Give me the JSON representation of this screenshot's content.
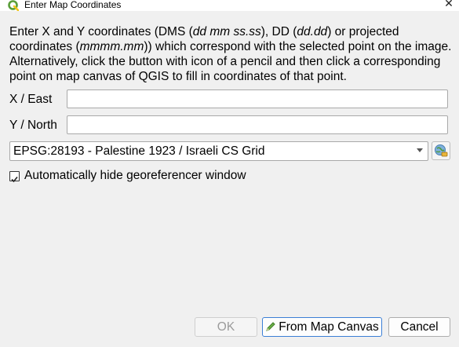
{
  "window": {
    "title": "Enter Map Coordinates",
    "close_glyph": "✕"
  },
  "description": {
    "p1": "Enter X and Y coordinates (DMS (",
    "p2": "dd mm ss.ss",
    "p3": "), DD (",
    "p4": "dd.dd",
    "p5": ") or projected coordinates (",
    "p6": "mmmm.mm",
    "p7": ")) which correspond with the selected point on the image. Alternatively, click the button with icon of a pencil and then click a corresponding point on map canvas of QGIS to fill in coordinates of that point."
  },
  "fields": {
    "x_label": "X / East",
    "x_value": "",
    "y_label": "Y / North",
    "y_value": ""
  },
  "crs": {
    "selected": "EPSG:28193 - Palestine 1923 / Israeli CS Grid"
  },
  "option": {
    "checked": true,
    "label": "Automatically hide georeferencer window"
  },
  "buttons": {
    "ok": "OK",
    "from_canvas": "From Map Canvas",
    "cancel": "Cancel"
  },
  "colors": {
    "background": "#f0f0f0",
    "focus_border": "#3b7fd6",
    "disabled_text": "#9b9b9b",
    "qgis_green": "#5a9e3a"
  },
  "icons": {
    "app": "qgis-logo-icon",
    "crs_selector": "globe-projection-icon",
    "pencil": "pencil-icon"
  }
}
